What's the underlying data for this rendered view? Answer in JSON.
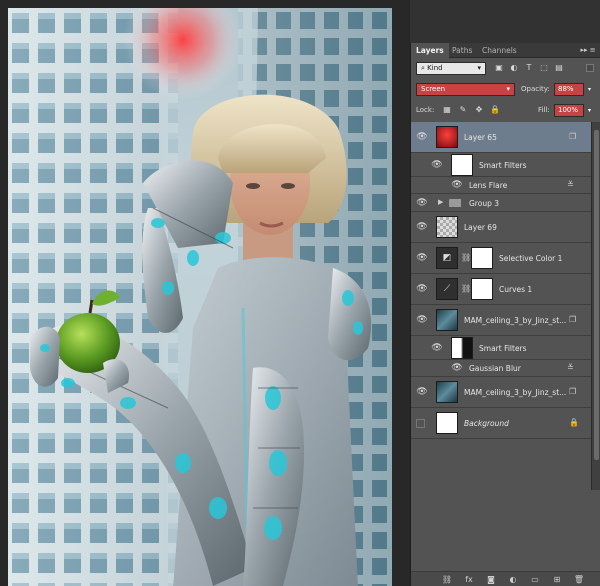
{
  "panel": {
    "tabs": [
      {
        "label": "Layers",
        "active": true
      },
      {
        "label": "Paths",
        "active": false
      },
      {
        "label": "Channels",
        "active": false
      }
    ],
    "menu_icon": "panel-menu-icon",
    "filter": {
      "kind_label": "Kind",
      "icons": [
        "pixel-filter-icon",
        "adjustment-filter-icon",
        "type-filter-icon",
        "shape-filter-icon",
        "smart-object-filter-icon"
      ]
    },
    "blend_mode": "Screen",
    "opacity_label": "Opacity:",
    "opacity_value": "88%",
    "lock_label": "Lock:",
    "fill_label": "Fill:",
    "fill_value": "100%",
    "accent_color": "#c74343",
    "selected_color": "#6e7d8e"
  },
  "layers": [
    {
      "name": "Layer 65",
      "type": "pixel",
      "selected": true,
      "visible": true
    },
    {
      "name": "Smart Filters",
      "type": "smart-filters-header",
      "visible": true
    },
    {
      "name": "Lens Flare",
      "type": "filter",
      "visible": true
    },
    {
      "name": "Group 3",
      "type": "group",
      "visible": true
    },
    {
      "name": "Layer 69",
      "type": "pixel",
      "visible": true
    },
    {
      "name": "Selective Color 1",
      "type": "adjustment",
      "visible": true
    },
    {
      "name": "Curves 1",
      "type": "adjustment",
      "visible": true
    },
    {
      "name": "MAM_ceiling_3_by_Jinz_st...",
      "type": "smart-object",
      "visible": true
    },
    {
      "name": "Smart Filters",
      "type": "smart-filters-header",
      "visible": true
    },
    {
      "name": "Gaussian Blur",
      "type": "filter",
      "visible": true
    },
    {
      "name": "MAM_ceiling_3_by_Jinz_st...",
      "type": "smart-object",
      "visible": true
    },
    {
      "name": "Background",
      "type": "background",
      "visible": false,
      "locked": true
    }
  ]
}
